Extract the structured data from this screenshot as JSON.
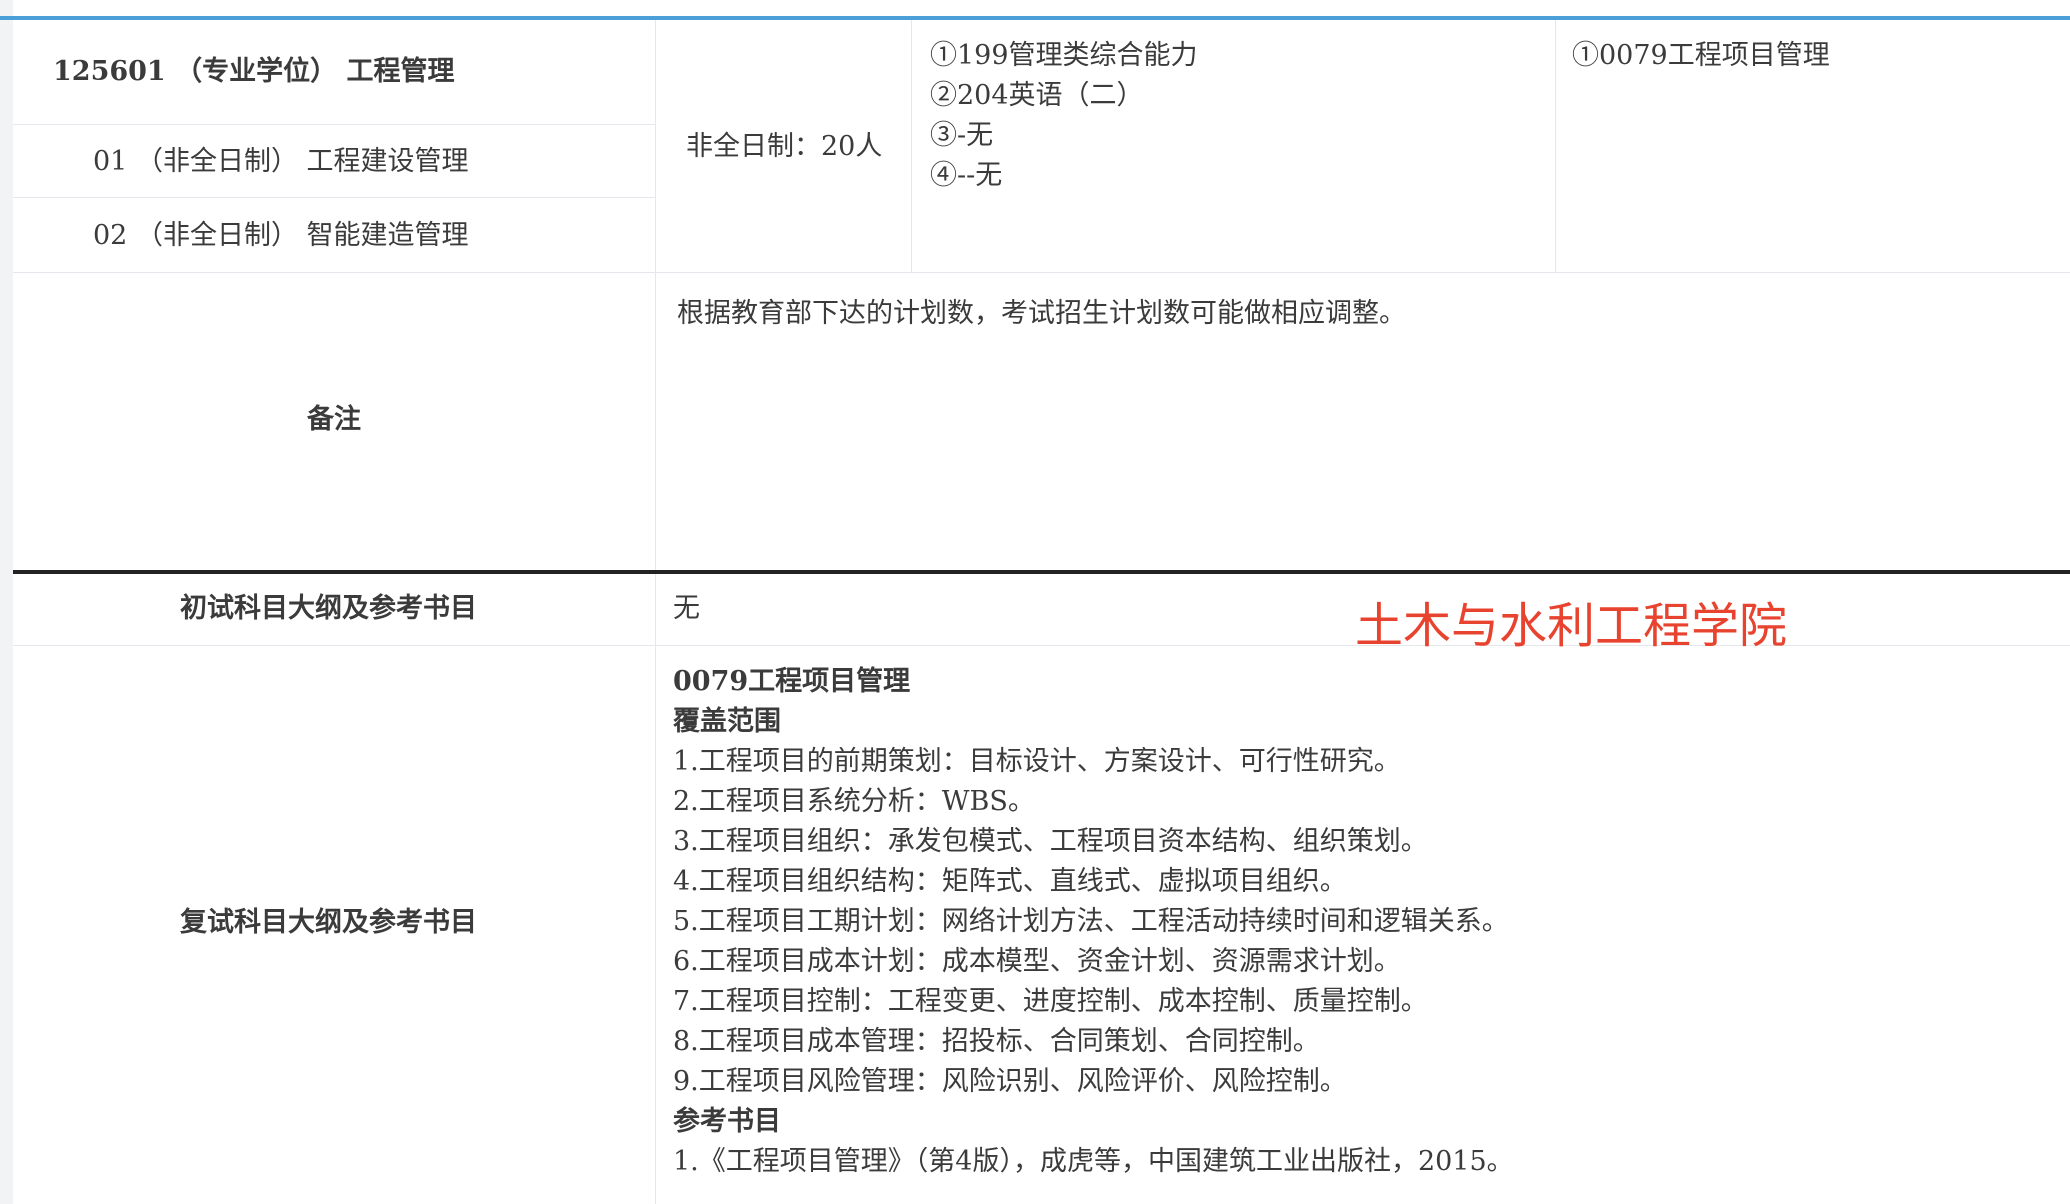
{
  "major": {
    "code_title": "125601 （专业学位） 工程管理",
    "directions": [
      {
        "label": "01 （非全日制） 工程建设管理"
      },
      {
        "label": "02 （非全日制） 智能建造管理"
      }
    ],
    "enrollment": "非全日制：20人",
    "exam_subjects": [
      "①199管理类综合能力",
      "②204英语（二）",
      "③-无",
      "④--无"
    ],
    "retest_subject": "①0079工程项目管理"
  },
  "remark": {
    "label": "备注",
    "text": "根据教育部下达的计划数，考试招生计划数可能做相应调整。"
  },
  "prelim": {
    "label": "初试科目大纲及参考书目",
    "value": "无"
  },
  "watermark": "土木与水利工程学院",
  "retest": {
    "label": "复试科目大纲及参考书目",
    "course_title": "0079工程项目管理",
    "scope_heading": "覆盖范围",
    "scope_items": [
      "1.工程项目的前期策划：目标设计、方案设计、可行性研究。",
      "2.工程项目系统分析：WBS。",
      "3.工程项目组织：承发包模式、工程项目资本结构、组织策划。",
      "4.工程项目组织结构：矩阵式、直线式、虚拟项目组织。",
      "5.工程项目工期计划：网络计划方法、工程活动持续时间和逻辑关系。",
      "6.工程项目成本计划：成本模型、资金计划、资源需求计划。",
      "7.工程项目控制：工程变更、进度控制、成本控制、质量控制。",
      "8.工程项目成本管理：招投标、合同策划、合同控制。",
      "9.工程项目风险管理：风险识别、风险评价、风险控制。"
    ],
    "ref_heading": "参考书目",
    "ref_items": [
      "1.《工程项目管理》（第4版），成虎等，中国建筑工业出版社，2015。"
    ]
  }
}
